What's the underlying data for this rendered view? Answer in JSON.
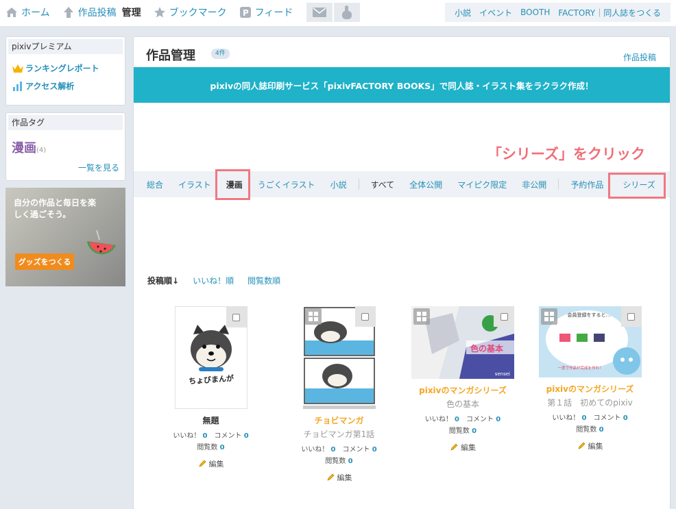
{
  "topbar": {
    "home": "ホーム",
    "post": "作品投稿",
    "manage": "管理",
    "bookmark": "ブックマーク",
    "feed": "フィード",
    "links": [
      "小説",
      "イベント",
      "BOOTH",
      "FACTORY｜同人誌をつくる"
    ]
  },
  "sidebar": {
    "premium_title": "pixivプレミアム",
    "ranking_report": "ランキングレポート",
    "access_analysis": "アクセス解析",
    "tags_title": "作品タグ",
    "tag_name": "漫画",
    "tag_count": "(4)",
    "see_all": "一覧を見る",
    "banner_text": "自分の作品と毎日を楽しく過ごそう。",
    "banner_button": "グッズをつくる"
  },
  "main": {
    "title": "作品管理",
    "count": "4件",
    "post_link": "作品投稿",
    "strip": "pixivの同人誌印刷サービス「pixivFACTORY BOOKS」で同人誌・イラスト集をラクラク作成！",
    "annotation": "「シリーズ」をクリック",
    "tabs": [
      "総合",
      "イラスト",
      "漫画",
      "うごくイラスト",
      "小説",
      "すべて",
      "全体公開",
      "マイピク限定",
      "非公開",
      "予約作品",
      "シリーズ"
    ],
    "sort": [
      "投稿順↓",
      "いいね！順",
      "閲覧数順"
    ],
    "likes_label": "いいね！",
    "comment_label": "コメント",
    "views_label": "閲覧数",
    "edit_label": "編集"
  },
  "works": [
    {
      "title": "無題",
      "subtitle": "",
      "likes": "0",
      "comments": "0",
      "views": "0",
      "thumb_text": "ちょびまんが"
    },
    {
      "title": "チョビマンガ",
      "subtitle": "チョビマンガ第1話",
      "likes": "0",
      "comments": "0",
      "views": "0"
    },
    {
      "title": "pixivのマンガシリーズ",
      "subtitle": "色の基本",
      "likes": "0",
      "comments": "0",
      "views": "0",
      "thumb_text": "色の基本",
      "thumb_small": "sensei"
    },
    {
      "title": "pixivのマンガシリーズ",
      "subtitle": "第１話　初めてのpixiv",
      "likes": "0",
      "comments": "0",
      "views": "0",
      "thumb_text": "会員登録をすると…",
      "thumb_caption": "一度で作品が完成を作れ！"
    }
  ],
  "colors": {
    "accent": "#258fb8",
    "strip": "#1fb2c9",
    "highlight": "#f07882",
    "series": "#f5a623"
  }
}
